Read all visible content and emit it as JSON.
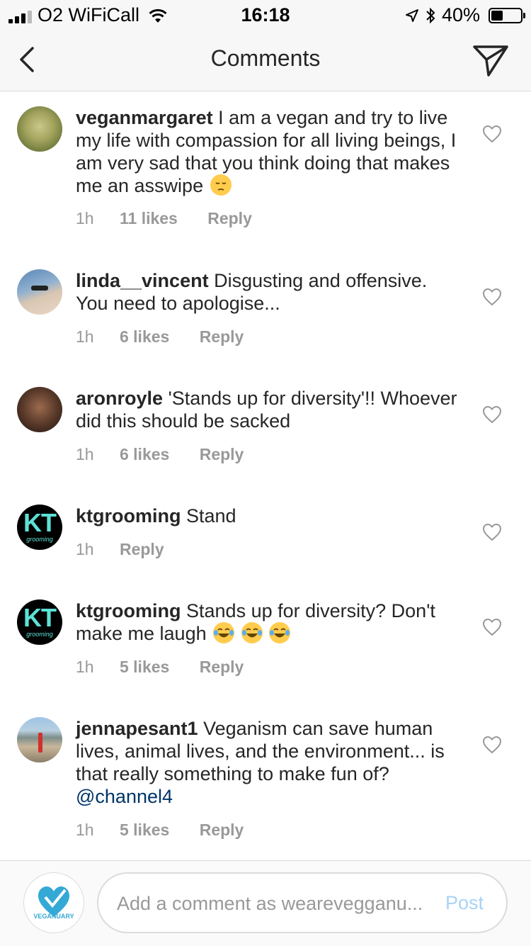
{
  "status_bar": {
    "carrier": "O2 WiFiCall",
    "time": "16:18",
    "battery": "40%"
  },
  "nav": {
    "title": "Comments"
  },
  "comments": [
    {
      "username": "veganmargaret",
      "text": "I am a vegan and try to live my life with compassion for all living beings, I am very sad that you think doing that makes me an asswipe",
      "emoji": "pensive-face",
      "time": "1h",
      "likes": "11 likes",
      "reply": "Reply"
    },
    {
      "username": "linda__vincent",
      "text": "Disgusting and offensive. You need to apologise...",
      "time": "1h",
      "likes": "6 likes",
      "reply": "Reply"
    },
    {
      "username": "aronroyle",
      "text": "'Stands up for diversity'!! Whoever did this should be sacked",
      "time": "1h",
      "likes": "6 likes",
      "reply": "Reply"
    },
    {
      "username": "ktgrooming",
      "text": "Stand",
      "time": "1h",
      "reply": "Reply"
    },
    {
      "username": "ktgrooming",
      "text": "Stands up for diversity? Don't make me laugh",
      "emoji": "tears-of-joy",
      "time": "1h",
      "likes": "5 likes",
      "reply": "Reply"
    },
    {
      "username": "jennapesant1",
      "text": "Veganism can save human lives, animal lives, and the environment... is that really something to make fun of?",
      "mention": "@channel4",
      "time": "1h",
      "likes": "5 likes",
      "reply": "Reply"
    }
  ],
  "avatar_logo": {
    "kt_text": "KT",
    "kt_sub": "grooming",
    "veganuary": "VEGANUARY"
  },
  "composer": {
    "placeholder": "Add a comment as wearevegganu...",
    "post_label": "Post"
  },
  "colors": {
    "username": "#262626",
    "meta": "#999999",
    "mention": "#003569",
    "post_disabled": "#a9d3f5",
    "kt_accent": "#5ce1d6",
    "veganuary": "#34a9d6"
  }
}
